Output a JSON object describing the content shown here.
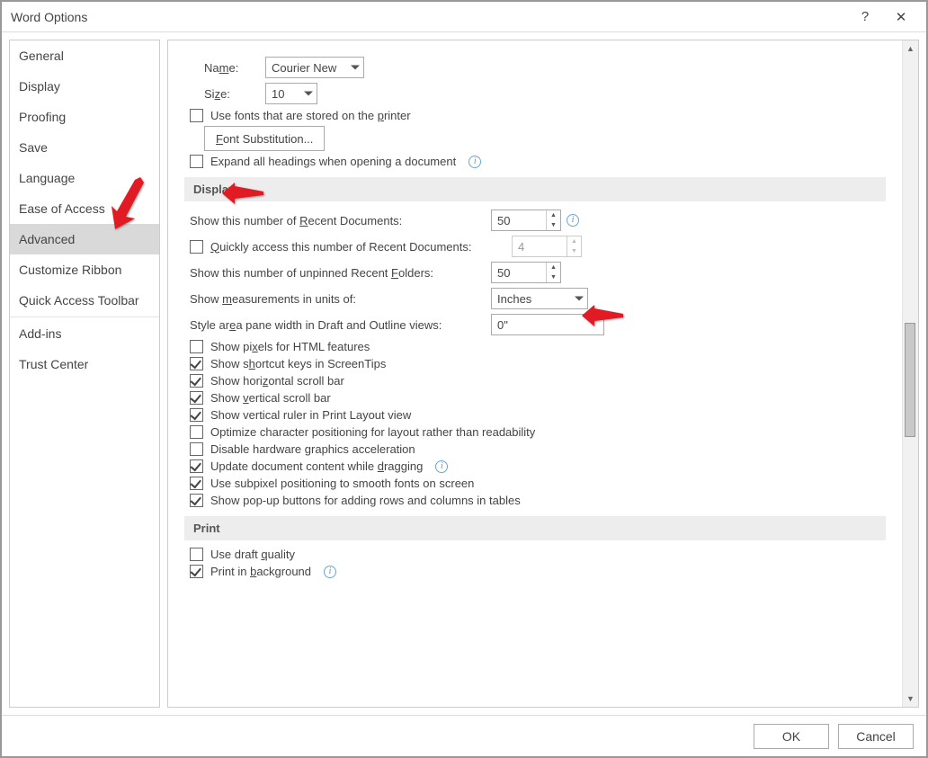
{
  "window": {
    "title": "Word Options",
    "help": "?",
    "close": "✕"
  },
  "sidebar": {
    "items": [
      {
        "id": "general",
        "label": "General"
      },
      {
        "id": "display",
        "label": "Display"
      },
      {
        "id": "proofing",
        "label": "Proofing"
      },
      {
        "id": "save",
        "label": "Save"
      },
      {
        "id": "language",
        "label": "Language"
      },
      {
        "id": "ease",
        "label": "Ease of Access"
      },
      {
        "id": "advanced",
        "label": "Advanced",
        "selected": true
      },
      {
        "id": "ribbon",
        "label": "Customize Ribbon"
      },
      {
        "id": "qat",
        "label": "Quick Access Toolbar"
      },
      {
        "id": "addins",
        "label": "Add-ins"
      },
      {
        "id": "trust",
        "label": "Trust Center"
      }
    ]
  },
  "font_section": {
    "name_label": "Name:",
    "name_value": "Courier New",
    "size_label": "Size:",
    "size_value": "10",
    "use_printer_fonts": "Use fonts that are stored on the printer",
    "font_sub_button": "Font Substitution...",
    "expand_headings": "Expand all headings when opening a document"
  },
  "display_section": {
    "header": "Display",
    "recent_docs_label": "Show this number of Recent Documents:",
    "recent_docs_value": "50",
    "quick_access_label": "Quickly access this number of Recent Documents:",
    "quick_access_value": "4",
    "recent_folders_label": "Show this number of unpinned Recent Folders:",
    "recent_folders_value": "50",
    "units_label": "Show measurements in units of:",
    "units_value": "Inches",
    "style_area_label": "Style area pane width in Draft and Outline views:",
    "style_area_value": "0\"",
    "opts": {
      "pixels_html": "Show pixels for HTML features",
      "shortcut": "Show shortcut keys in ScreenTips",
      "hscroll": "Show horizontal scroll bar",
      "vscroll": "Show vertical scroll bar",
      "vruler": "Show vertical ruler in Print Layout view",
      "opt_char": "Optimize character positioning for layout rather than readability",
      "hw_gfx": "Disable hardware graphics acceleration",
      "drag_update": "Update document content while dragging",
      "subpixel": "Use subpixel positioning to smooth fonts on screen",
      "popup_btns": "Show pop-up buttons for adding rows and columns in tables"
    }
  },
  "print_section": {
    "header": "Print",
    "draft": "Use draft quality",
    "background": "Print in background"
  },
  "footer": {
    "ok": "OK",
    "cancel": "Cancel"
  }
}
